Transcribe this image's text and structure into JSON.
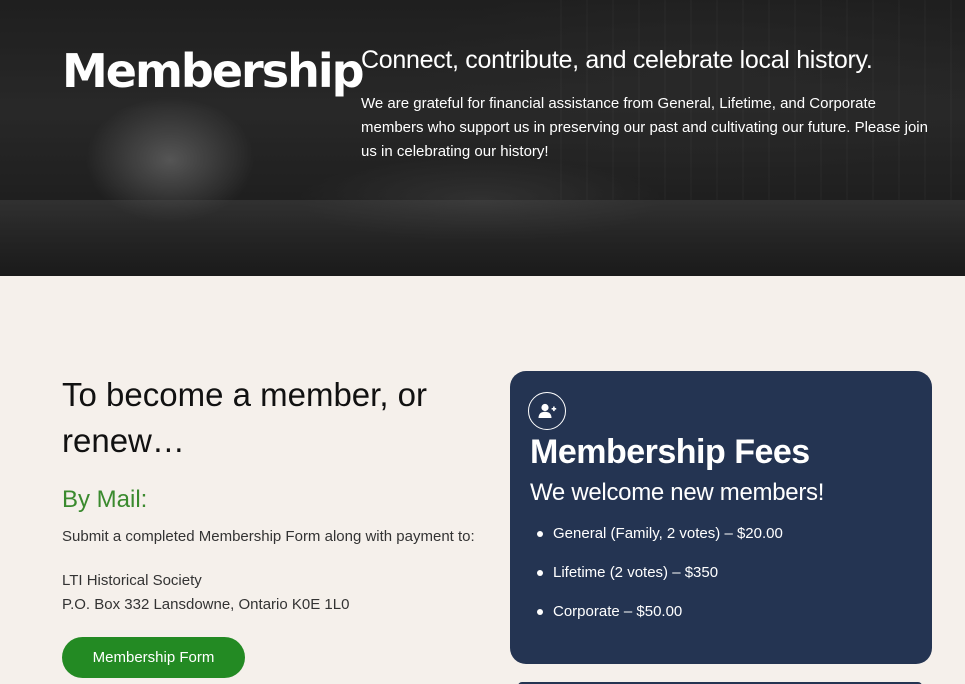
{
  "hero": {
    "title": "Membership",
    "tagline": "Connect, contribute, and celebrate local history.",
    "body": "We are grateful for financial assistance from General, Lifetime, and Corporate members who support us in preserving our past and cultivating our future. Please join us in celebrating our history!"
  },
  "join": {
    "heading": "To become a member, or renew…",
    "by_mail": "By Mail:",
    "instructions": "Submit a completed Membership Form along with payment to:",
    "address_line1": "LTI Historical Society",
    "address_line2": "P.O. Box 332 Lansdowne, Ontario K0E 1L0",
    "form_button": "Membership Form"
  },
  "fees": {
    "icon": "user-plus-icon",
    "title": "Membership Fees",
    "subtitle": "We welcome new members!",
    "items": [
      "General (Family, 2 votes) – $20.00",
      "Lifetime (2 votes) – $350",
      "Corporate – $50.00"
    ]
  },
  "colors": {
    "background": "#f5f0eb",
    "accent_green": "#238a23",
    "heading_green": "#3a8a2e",
    "card_navy": "#243452"
  }
}
